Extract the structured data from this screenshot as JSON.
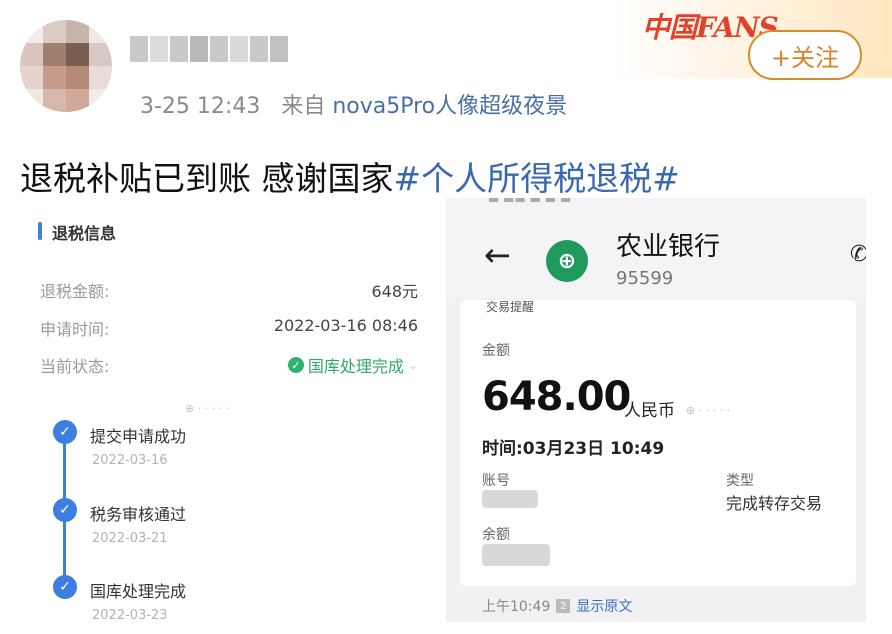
{
  "post": {
    "time": "3-25 12:43",
    "source_prefix": "来自",
    "source": "nova5Pro人像超级夜景",
    "text": "退税补贴已到账 感谢国家",
    "hashtag": "#个人所得税退税#",
    "follow_label": "+关注",
    "badge_text": "中国FANS"
  },
  "tax_refund": {
    "section_title": "退税信息",
    "rows": [
      {
        "label": "退税金额:",
        "value": "648元"
      },
      {
        "label": "申请时间:",
        "value": "2022-03-16 08:46"
      },
      {
        "label": "当前状态:",
        "value": "国库处理完成"
      }
    ],
    "timeline": [
      {
        "title": "提交申请成功",
        "date": "2022-03-16"
      },
      {
        "title": "税务审核通过",
        "date": "2022-03-21"
      },
      {
        "title": "国库处理完成",
        "date": "2022-03-23"
      }
    ]
  },
  "bank_sms": {
    "bank_name": "农业银行",
    "number": "95599",
    "message_title": "交易提醒",
    "amount_label": "金额",
    "amount": "648.00",
    "currency": "人民币",
    "time": "时间:03月23日 10:49",
    "account_label": "账号",
    "type_label": "类型",
    "type_value": "完成转存交易",
    "balance_label": "余额",
    "footer_time": "上午10:49",
    "footer_link": "显示原文"
  },
  "colors": {
    "accent_blue": "#3d7fe0",
    "status_green": "#2fa86a",
    "abc_green": "#1f9a5d",
    "follow_orange": "#d9822b",
    "hashtag_blue": "#3a68b0"
  }
}
